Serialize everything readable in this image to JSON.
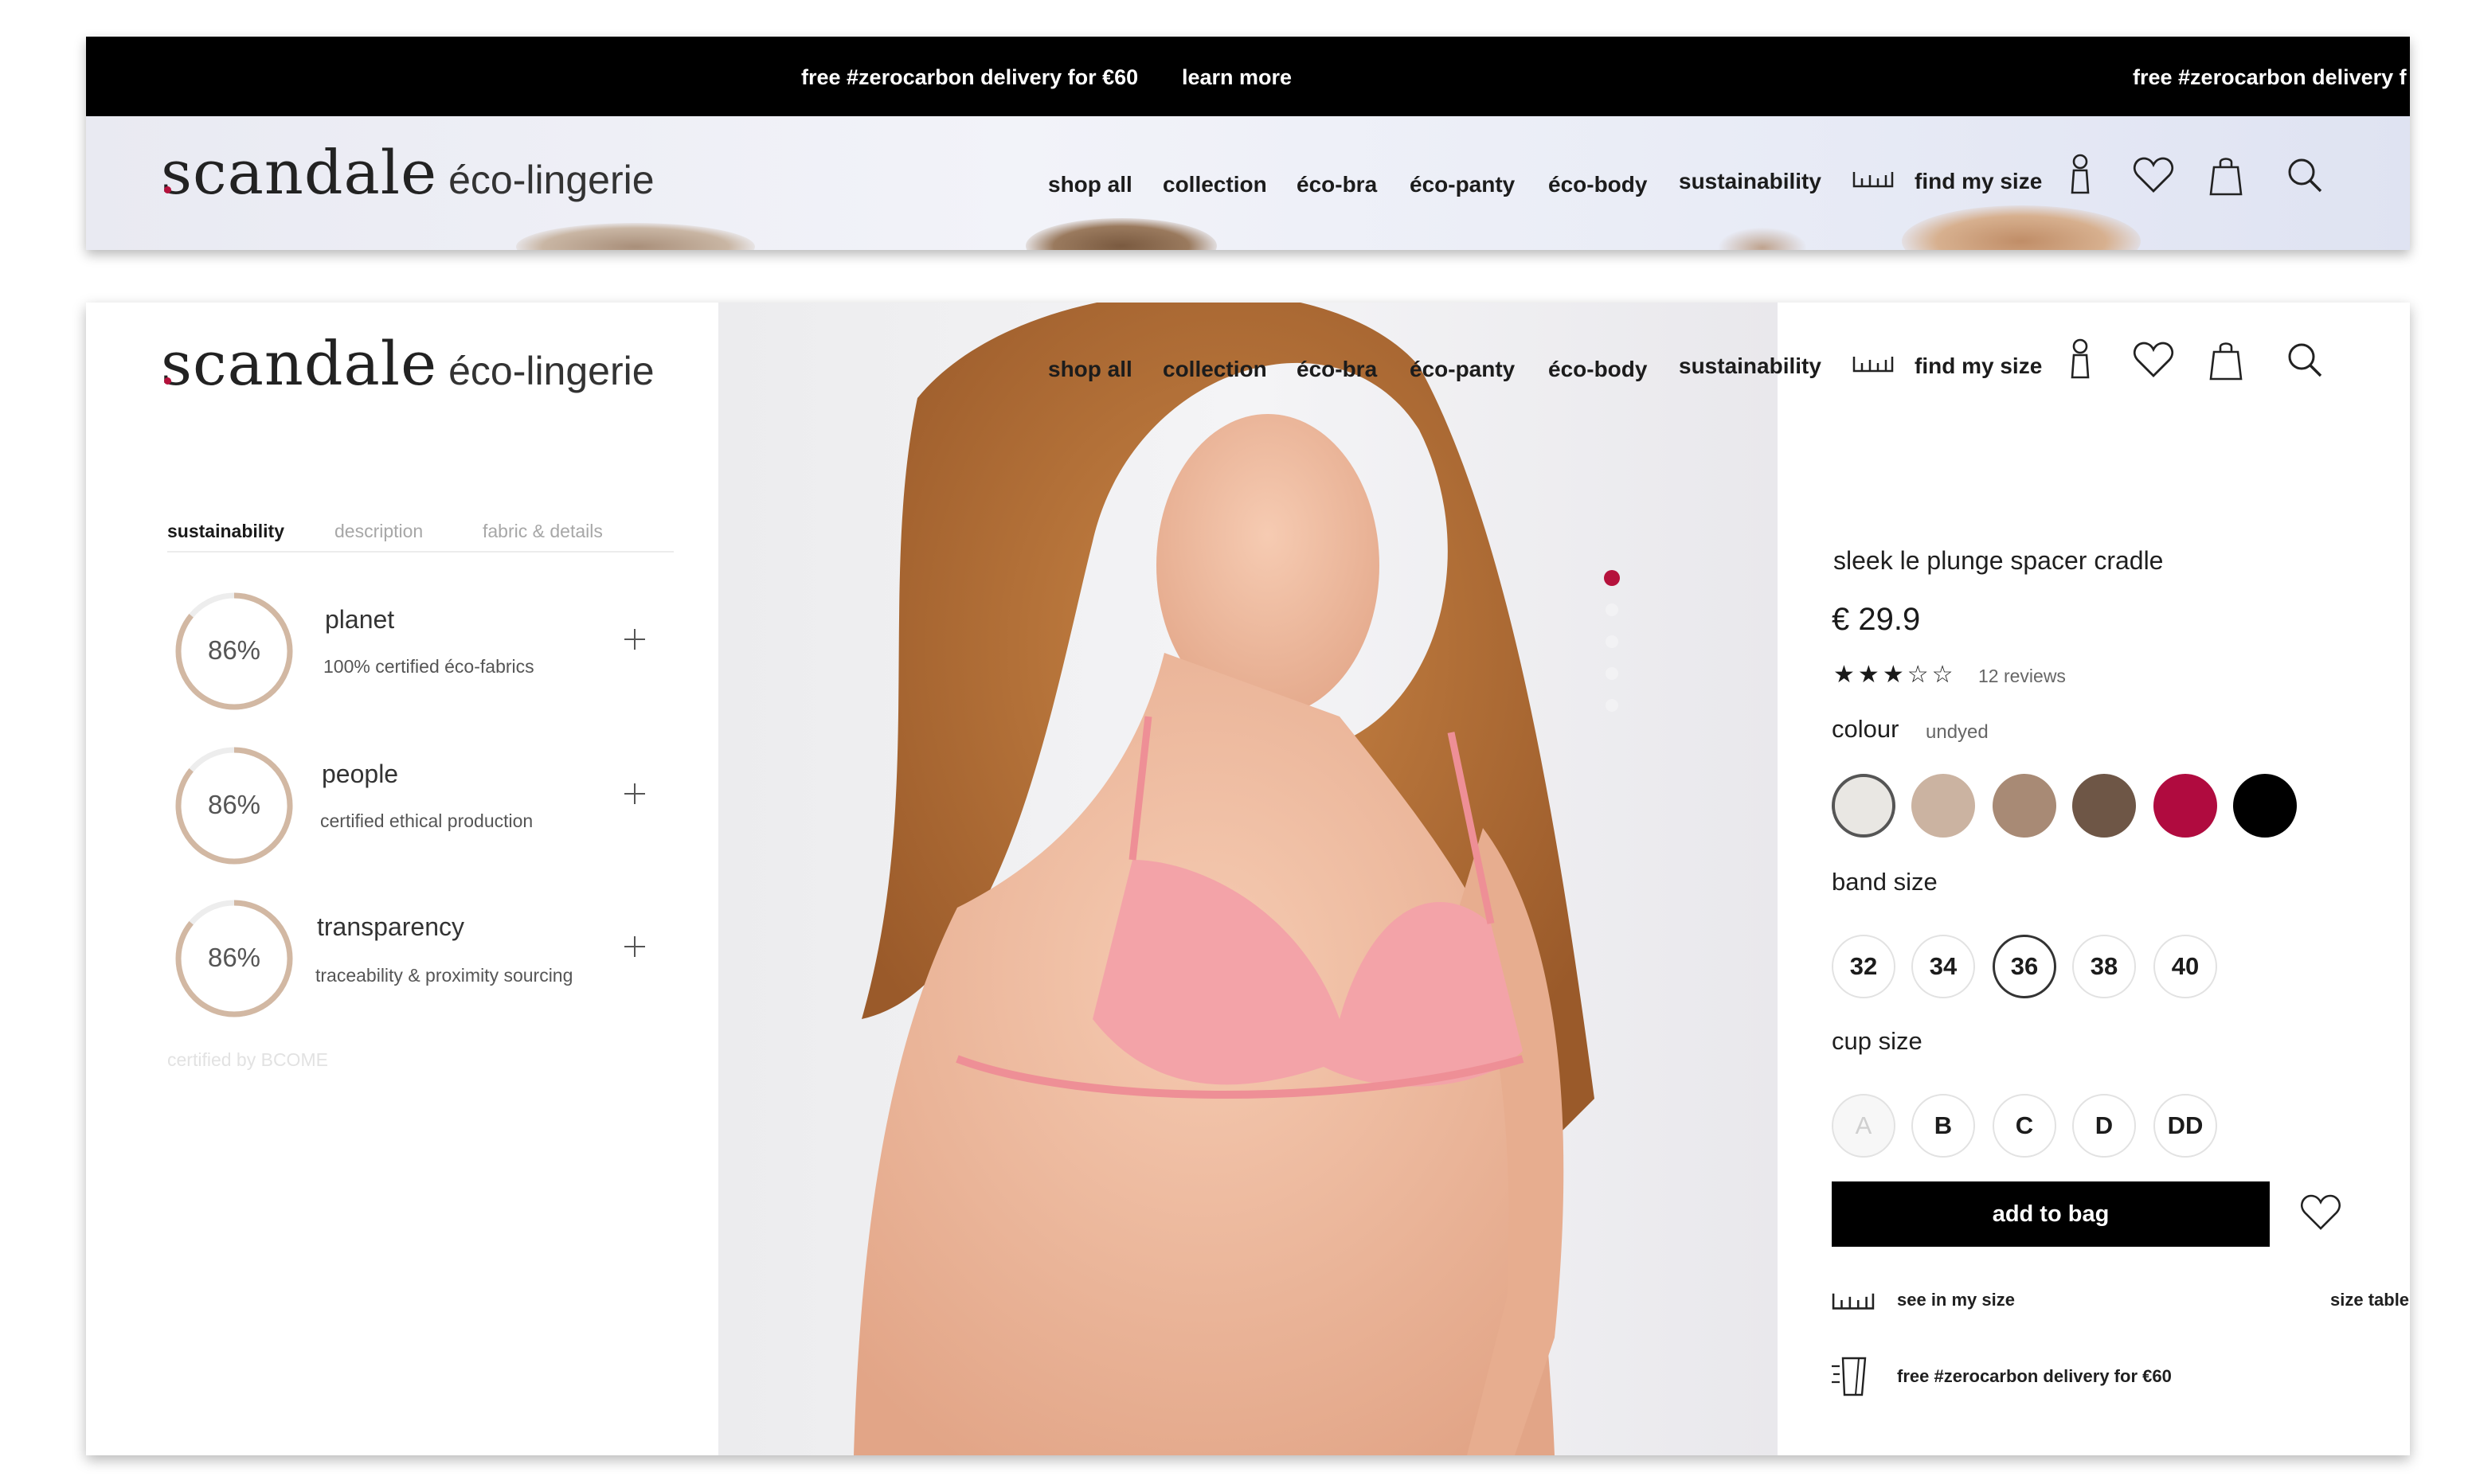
{
  "announcement": {
    "promo": "free #zerocarbon delivery for €60",
    "link": "learn more",
    "promo_repeat": "free #zerocarbon delivery f"
  },
  "brand": {
    "name": "scandale",
    "tagline": "éco-lingerie"
  },
  "nav": {
    "items": [
      "shop all",
      "collection",
      "éco-bra",
      "éco-panty",
      "éco-body",
      "sustainability"
    ],
    "find_my_size": "find my size",
    "icons": [
      "ruler-icon",
      "account-icon",
      "wishlist-heart-icon",
      "bag-icon",
      "search-icon"
    ]
  },
  "tabs": {
    "items": [
      "sustainability",
      "description",
      "fabric & details"
    ],
    "active": "sustainability"
  },
  "metrics": [
    {
      "value": "86%",
      "progress": 0.86,
      "title": "planet",
      "subtitle": "100% certified éco-fabrics"
    },
    {
      "value": "86%",
      "progress": 0.86,
      "title": "people",
      "subtitle": "certified ethical production"
    },
    {
      "value": "86%",
      "progress": 0.86,
      "title": "transparency",
      "subtitle": "traceability & proximity sourcing"
    }
  ],
  "certified": "certified by BCOME",
  "carousel": {
    "slides": 5,
    "active_index": 0
  },
  "product": {
    "name": "sleek le plunge spacer cradle",
    "price": "€ 29.9",
    "rating": 3,
    "rating_max": 5,
    "reviews": "12 reviews",
    "colour_label": "colour",
    "colour_value": "undyed",
    "colours": [
      "#e9e7e3",
      "#cbb3a1",
      "#a88a75",
      "#6e5646",
      "#b00b3f",
      "#000000"
    ],
    "selected_colour_index": 0,
    "band_size_label": "band size",
    "band_sizes": [
      "32",
      "34",
      "36",
      "38",
      "40"
    ],
    "selected_band_size": "36",
    "cup_size_label": "cup size",
    "cup_sizes": [
      "A",
      "B",
      "C",
      "D",
      "DD"
    ],
    "unavailable_cup_sizes": [
      "A"
    ],
    "add_to_bag": "add to bag",
    "see_in_my_size": "see in my size",
    "size_table": "size table",
    "delivery_note": "free #zerocarbon delivery for €60"
  },
  "colors": {
    "accent": "#b5123c",
    "ring": "#d2b8a3",
    "ring_track": "#ededed"
  }
}
